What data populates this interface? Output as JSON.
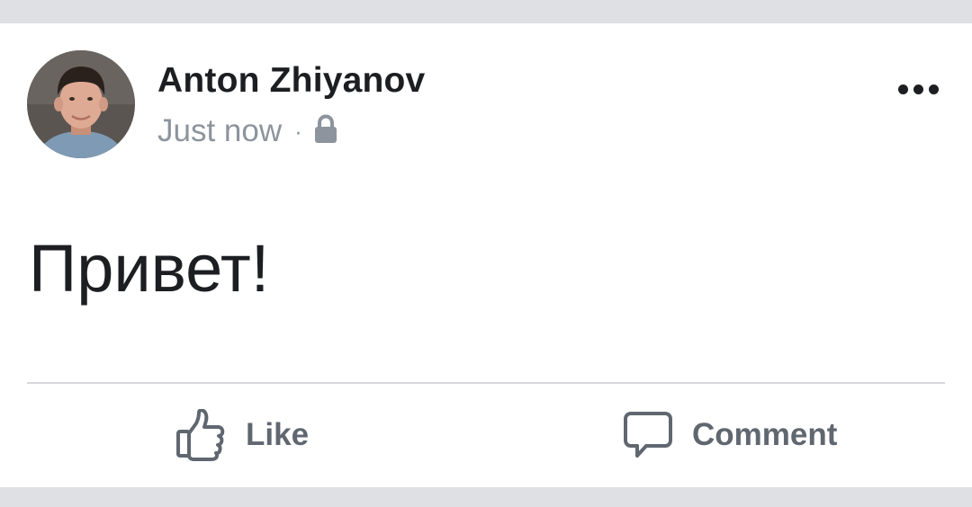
{
  "post": {
    "author": "Anton Zhiyanov",
    "timestamp": "Just now",
    "separator": "·",
    "privacy_icon": "lock-icon",
    "menu_icon": "more-options-icon",
    "body": "Привет!"
  },
  "actions": {
    "like_label": "Like",
    "like_icon": "thumbs-up-icon",
    "comment_label": "Comment",
    "comment_icon": "speech-bubble-icon"
  },
  "colors": {
    "background": "#dfe0e4",
    "card": "#ffffff",
    "primary_text": "#1c1e21",
    "secondary_text": "#8d949e",
    "action_text": "#606770",
    "divider": "#d6d8dc"
  }
}
